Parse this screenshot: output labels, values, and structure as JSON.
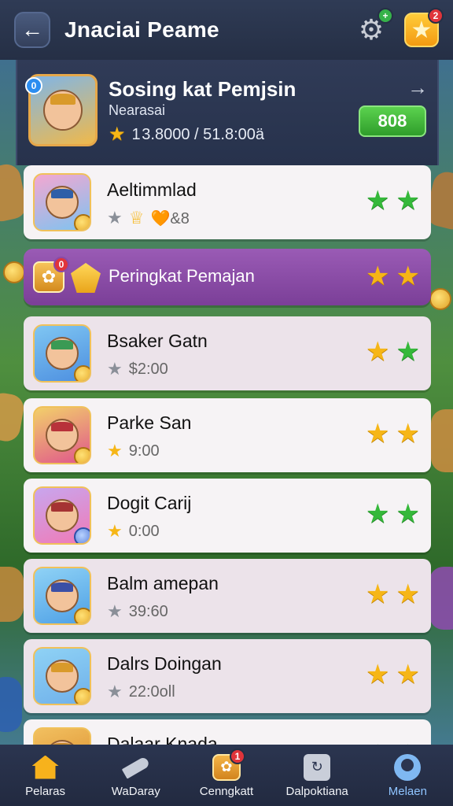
{
  "header": {
    "title": "Jnaciai Peame",
    "back_icon": "arrow-left-icon",
    "settings_badge": "+",
    "star_badge": "2"
  },
  "player": {
    "tag": "0",
    "name": "Sosing kat Pemjsin",
    "subtitle": "Nearasai",
    "stats": "1 3.8000 / 51.8:00ä",
    "score": "808",
    "arrow": "→"
  },
  "list": [
    {
      "name": "Aeltimmlad",
      "sub": "★☆☆",
      "sub_text": "🧡&8",
      "stars": [
        "green",
        "green"
      ],
      "sub_star": "grey",
      "alt": false
    },
    {
      "name": "Bsaker Gatn",
      "sub_text": "$2:00",
      "stars": [
        "gold",
        "green"
      ],
      "sub_star": "grey",
      "alt": true
    },
    {
      "name": "Parke San",
      "sub_text": "9:00",
      "stars": [
        "gold",
        "gold"
      ],
      "sub_star": "gold",
      "alt": false
    },
    {
      "name": "Dogit Carij",
      "sub_text": "0:00",
      "stars": [
        "green",
        "green"
      ],
      "sub_star": "gold",
      "alt": false
    },
    {
      "name": "Balm amepan",
      "sub_text": "39:60",
      "stars": [
        "gold",
        "gold"
      ],
      "sub_star": "grey",
      "alt": true
    },
    {
      "name": "Dalrs Doingan",
      "sub_text": "22:0oll",
      "stars": [
        "gold",
        "gold"
      ],
      "sub_star": "grey",
      "alt": true
    },
    {
      "name": "Dalaar Knada",
      "sub_text": "",
      "stars": [
        "green",
        "green"
      ],
      "sub_star": "grey",
      "alt": false
    }
  ],
  "banner": {
    "label": "Peringkat Pemajan",
    "badge": "0",
    "stars": [
      "gold",
      "gold"
    ]
  },
  "nav": [
    {
      "label": "Pelaras",
      "icon": "home-icon"
    },
    {
      "label": "WaDaray",
      "icon": "rocket-icon"
    },
    {
      "label": "Cenngkatt",
      "icon": "ranking-icon",
      "badge": "1"
    },
    {
      "label": "Dalpoktiana",
      "icon": "shop-icon"
    },
    {
      "label": "Melaen",
      "icon": "profile-icon",
      "active": true
    }
  ],
  "colors": {
    "header_bg": "#2f3b55",
    "accent_green": "#35b83a",
    "accent_gold": "#f6b617",
    "banner_purple": "#8a4aa6",
    "nav_active": "#8fc4ff"
  }
}
